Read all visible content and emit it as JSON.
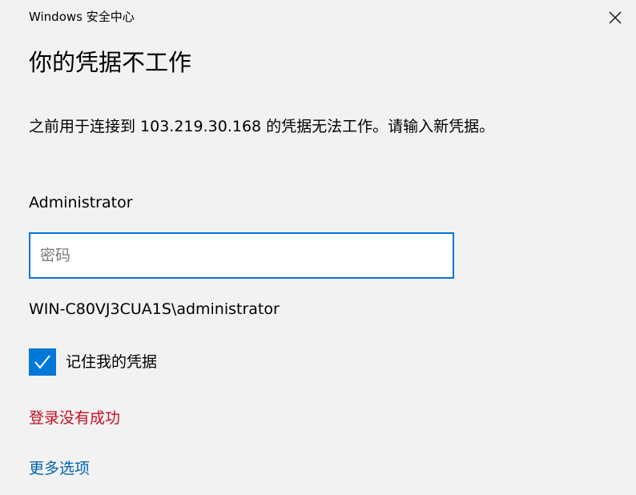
{
  "window": {
    "app_title": "Windows 安全中心",
    "close_icon": "close-icon"
  },
  "dialog": {
    "heading": "你的凭据不工作",
    "message": "之前用于连接到 103.219.30.168 的凭据无法工作。请输入新凭据。",
    "username": "Administrator",
    "password": {
      "placeholder": "密码",
      "value": ""
    },
    "domain_user": "WIN-C80VJ3CUA1S\\administrator",
    "remember": {
      "label": "记住我的凭据",
      "checked": true,
      "icon": "checkmark-icon"
    },
    "error_text": "登录没有成功",
    "more_options": "更多选项"
  },
  "colors": {
    "accent": "#0078d7",
    "error": "#c50f1f",
    "link": "#0063b1",
    "background": "#f2f2f2"
  }
}
